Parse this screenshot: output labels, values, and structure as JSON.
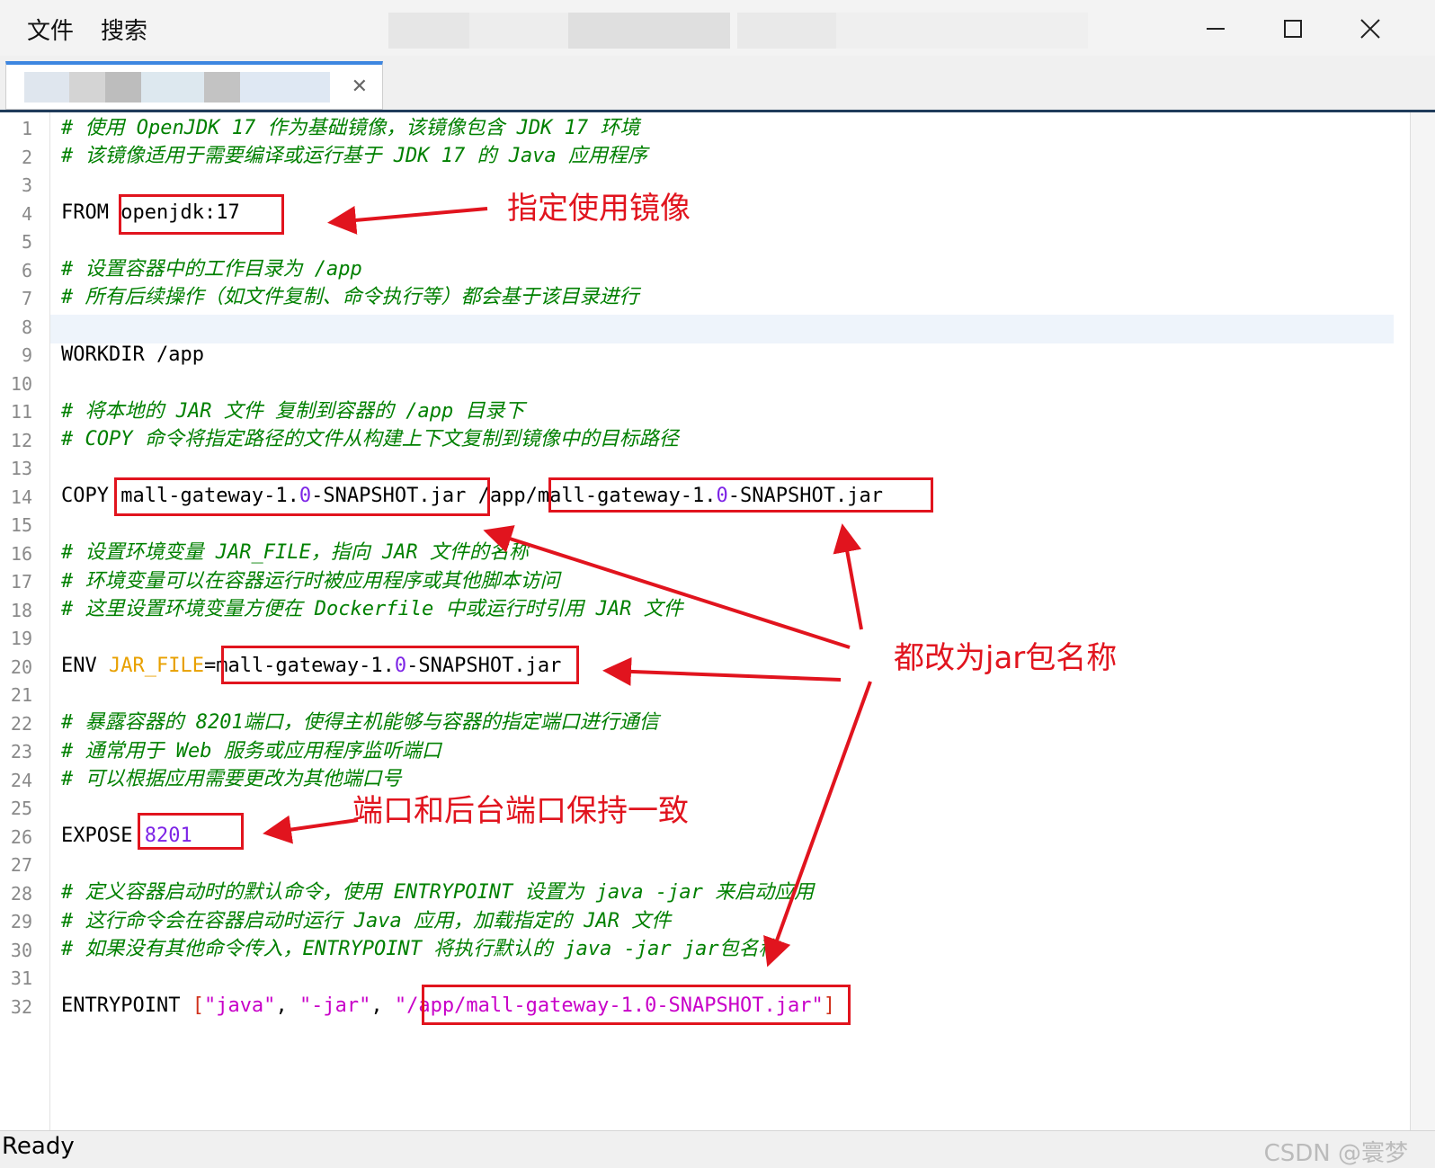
{
  "menu": {
    "file": "文件",
    "search": "搜索"
  },
  "window": {
    "minimize_icon": "minimize-icon",
    "maximize_icon": "maximize-icon",
    "close_icon": "close-icon"
  },
  "tab": {
    "close_glyph": "✕"
  },
  "colors": {
    "comment": "#008000",
    "number": "#7d24e6",
    "annotation": "#e1141e",
    "accent": "#3d86e0"
  },
  "lines": [
    {
      "n": "1"
    },
    {
      "n": "2"
    },
    {
      "n": "3"
    },
    {
      "n": "4"
    },
    {
      "n": "5"
    },
    {
      "n": "6"
    },
    {
      "n": "7"
    },
    {
      "n": "8"
    },
    {
      "n": "9"
    },
    {
      "n": "10"
    },
    {
      "n": "11"
    },
    {
      "n": "12"
    },
    {
      "n": "13"
    },
    {
      "n": "14"
    },
    {
      "n": "15"
    },
    {
      "n": "16"
    },
    {
      "n": "17"
    },
    {
      "n": "18"
    },
    {
      "n": "19"
    },
    {
      "n": "20"
    },
    {
      "n": "21"
    },
    {
      "n": "22"
    },
    {
      "n": "23"
    },
    {
      "n": "24"
    },
    {
      "n": "25"
    },
    {
      "n": "26"
    },
    {
      "n": "27"
    },
    {
      "n": "28"
    },
    {
      "n": "29"
    },
    {
      "n": "30"
    },
    {
      "n": "31"
    },
    {
      "n": "32"
    }
  ],
  "code": {
    "l1": "# 使用 OpenJDK 17 作为基础镜像，该镜像包含 JDK 17 环境",
    "l2": "# 该镜像适用于需要编译或运行基于 JDK 17 的 Java 应用程序",
    "l4_kw": "FROM ",
    "l4_img": "openjdk:17",
    "l6": "# 设置容器中的工作目录为 /app",
    "l7": "# 所有后续操作（如文件复制、命令执行等）都会基于该目录进行",
    "l9": "WORKDIR /app",
    "l11": "# 将本地的 JAR 文件 复制到容器的 /app 目录下",
    "l12": "# COPY 命令将指定路径的文件从构建上下文复制到镜像中的目标路径",
    "l14_kw": "COPY ",
    "l14_a": "mall-gateway-1.",
    "l14_zero": "0",
    "l14_b": "-SNAPSHOT.jar",
    "l14_mid": " /app/",
    "l14_c": "mall-gateway-1.",
    "l14_zero2": "0",
    "l14_d": "-SNAPSHOT.jar",
    "l16": "# 设置环境变量 JAR_FILE，指向 JAR 文件的名称",
    "l17": "# 环境变量可以在容器运行时被应用程序或其他脚本访问",
    "l18": "# 这里设置环境变量方便在 Dockerfile 中或运行时引用 JAR 文件",
    "l20_kw": "ENV ",
    "l20_var": "JAR_FILE",
    "l20_eq": "=",
    "l20_a": "mall-gateway-1.",
    "l20_zero": "0",
    "l20_b": "-SNAPSHOT.jar",
    "l22": "# 暴露容器的 8201端口，使得主机能够与容器的指定端口进行通信",
    "l23": "# 通常用于 Web 服务或应用程序监听端口",
    "l24": "# 可以根据应用需要更改为其他端口号",
    "l26_kw": "EXPOSE ",
    "l26_port": "8201",
    "l28": "# 定义容器启动时的默认命令，使用 ENTRYPOINT 设置为 java -jar 来启动应用",
    "l29": "# 这行命令会在容器启动时运行 Java 应用，加载指定的 JAR 文件",
    "l30": "# 如果没有其他命令传入，ENTRYPOINT 将执行默认的 java -jar jar包名称",
    "l32_kw": "ENTRYPOINT ",
    "l32_open": "[",
    "l32_s1": "\"java\"",
    "l32_c1": ", ",
    "l32_s2": "\"-jar\"",
    "l32_c2": ", ",
    "l32_s3": "\"/app/mall-gateway-1.0-SNAPSHOT.jar\"",
    "l32_close": "]"
  },
  "annotations": {
    "image": "指定使用镜像",
    "jar": "都改为jar包名称",
    "port": "端口和后台端口保持一致"
  },
  "status": {
    "text": "Ready",
    "watermark": "CSDN @寰梦"
  }
}
